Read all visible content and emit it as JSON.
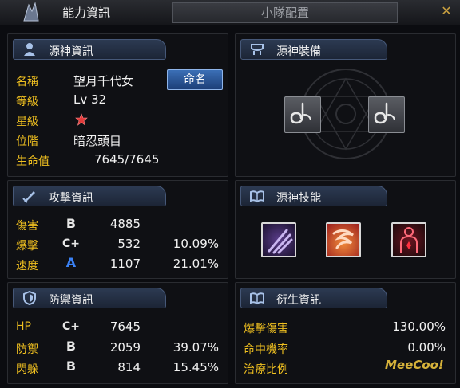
{
  "tabs": {
    "active": "能力資訊",
    "inactive": "小隊配置"
  },
  "panels": {
    "info": {
      "title": "源神資訊",
      "rename": "命名",
      "rows": [
        {
          "label": "名稱",
          "value": "望月千代女"
        },
        {
          "label": "等級",
          "value": "Lv 32"
        },
        {
          "label": "星級",
          "value": ""
        },
        {
          "label": "位階",
          "value": "暗忍頭目"
        },
        {
          "label": "生命值",
          "value": "7645/7645"
        }
      ]
    },
    "equip": {
      "title": "源神裝備"
    },
    "attack": {
      "title": "攻擊資訊",
      "rows": [
        {
          "label": "傷害",
          "grade": "B",
          "value": "4885",
          "pct": ""
        },
        {
          "label": "爆擊",
          "grade": "C+",
          "value": "532",
          "pct": "10.09%"
        },
        {
          "label": "速度",
          "grade": "A",
          "value": "1107",
          "pct": "21.01%"
        }
      ]
    },
    "skills": {
      "title": "源神技能"
    },
    "defense": {
      "title": "防禦資訊",
      "rows": [
        {
          "label": "HP",
          "grade": "C+",
          "value": "7645",
          "pct": ""
        },
        {
          "label": "防禦",
          "grade": "B",
          "value": "2059",
          "pct": "39.07%"
        },
        {
          "label": "閃躲",
          "grade": "B",
          "value": "814",
          "pct": "15.45%"
        }
      ]
    },
    "derived": {
      "title": "衍生資訊",
      "rows": [
        {
          "label": "爆擊傷害",
          "value": "130.00%"
        },
        {
          "label": "命中機率",
          "value": "0.00%"
        },
        {
          "label": "治療比例",
          "value": ""
        }
      ]
    }
  },
  "watermark": "MeeCoo!",
  "colors": {
    "label": "#f0c020",
    "grade_a": "#3b82f6",
    "grade_b": "#e6e6e6",
    "grade_c": "#e6e6e6"
  },
  "icons": [
    "app-icon",
    "person-icon",
    "equip-icon",
    "sword-icon",
    "book-icon",
    "shield-icon",
    "star-icon",
    "hook-icon",
    "claw-skill-icon",
    "fire-skill-icon",
    "body-skill-icon",
    "close-icon"
  ]
}
